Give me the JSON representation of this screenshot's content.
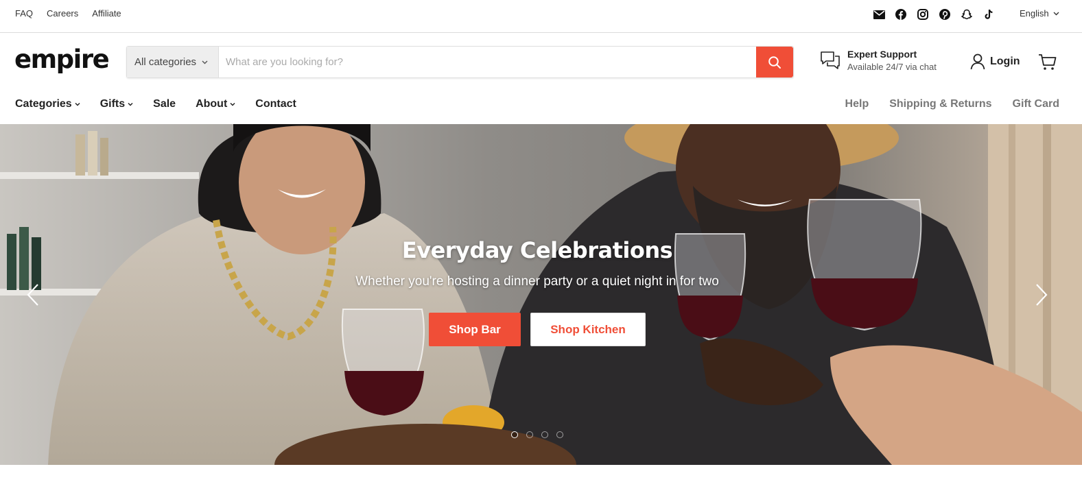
{
  "topbar": {
    "links": [
      "FAQ",
      "Careers",
      "Affiliate"
    ],
    "social_icons": [
      "email-icon",
      "facebook-icon",
      "instagram-icon",
      "pinterest-icon",
      "snapchat-icon",
      "tiktok-icon"
    ],
    "language": "English"
  },
  "header": {
    "logo": "empire",
    "search": {
      "category": "All categories",
      "placeholder": "What are you looking for?"
    },
    "support": {
      "title": "Expert Support",
      "subtitle": "Available 24/7 via chat"
    },
    "login_label": "Login"
  },
  "nav": {
    "left": [
      {
        "label": "Categories",
        "dropdown": true
      },
      {
        "label": "Gifts",
        "dropdown": true
      },
      {
        "label": "Sale",
        "dropdown": false
      },
      {
        "label": "About",
        "dropdown": true
      },
      {
        "label": "Contact",
        "dropdown": false
      }
    ],
    "right": [
      "Help",
      "Shipping & Returns",
      "Gift Card"
    ]
  },
  "hero": {
    "title": "Everyday Celebrations",
    "subtitle": "Whether you're hosting a dinner party or a quiet night in for two",
    "primary_button": "Shop Bar",
    "secondary_button": "Shop Kitchen",
    "slide_count": 4,
    "active_slide": 1
  },
  "colors": {
    "accent": "#f04e37",
    "text": "#222222",
    "muted": "#777777"
  }
}
